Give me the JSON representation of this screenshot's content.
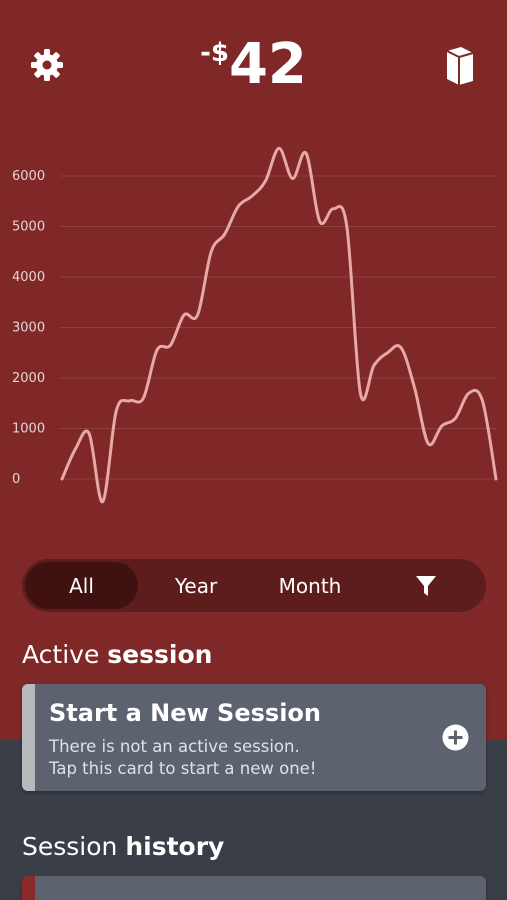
{
  "header": {
    "balance_prefix": "-$",
    "balance_amount": "42",
    "settings_icon": "gear-icon",
    "journal_icon": "book-icon"
  },
  "colors": {
    "primary_red": "#7f2827",
    "dark_slate": "#3a3e47",
    "card_gray": "#5c636e"
  },
  "chart_data": {
    "type": "line",
    "x": [
      0,
      1,
      2,
      3,
      4,
      5,
      6,
      7,
      8,
      9,
      10,
      11,
      12,
      13,
      14,
      15,
      16,
      17,
      18,
      19,
      20,
      21,
      22,
      23,
      24,
      25,
      26,
      27,
      28,
      29,
      30,
      31,
      32,
      33,
      34,
      35,
      36,
      37,
      38,
      39,
      40
    ],
    "series": [
      {
        "values": [
          0,
          600,
          900,
          -450,
          1350,
          1550,
          1600,
          2550,
          2650,
          3250,
          3250,
          4500,
          4850,
          5400,
          5600,
          5900,
          6550,
          5950,
          6450,
          5100,
          5350,
          5000,
          1700,
          2250,
          2500,
          2600,
          1800,
          700,
          1050,
          1200,
          1700,
          1550,
          0
        ]
      }
    ],
    "yticks": [
      "0",
      "1000",
      "2000",
      "3000",
      "4000",
      "5000",
      "6000"
    ],
    "ylim": [
      -500,
      6700
    ],
    "grid": true,
    "line_color": "#e6a9a6"
  },
  "filters": {
    "items": [
      "All",
      "Year",
      "Month"
    ],
    "active": "All",
    "filter_icon": "funnel-icon"
  },
  "active_session": {
    "title_normal": "Active ",
    "title_bold": "session",
    "card_title": "Start a New Session",
    "desc_line1": "There is not an active session.",
    "desc_line2": "Tap this card to start a new one!",
    "add_icon": "plus-circle-icon"
  },
  "session_history": {
    "title_normal": "Session ",
    "title_bold": "history"
  }
}
